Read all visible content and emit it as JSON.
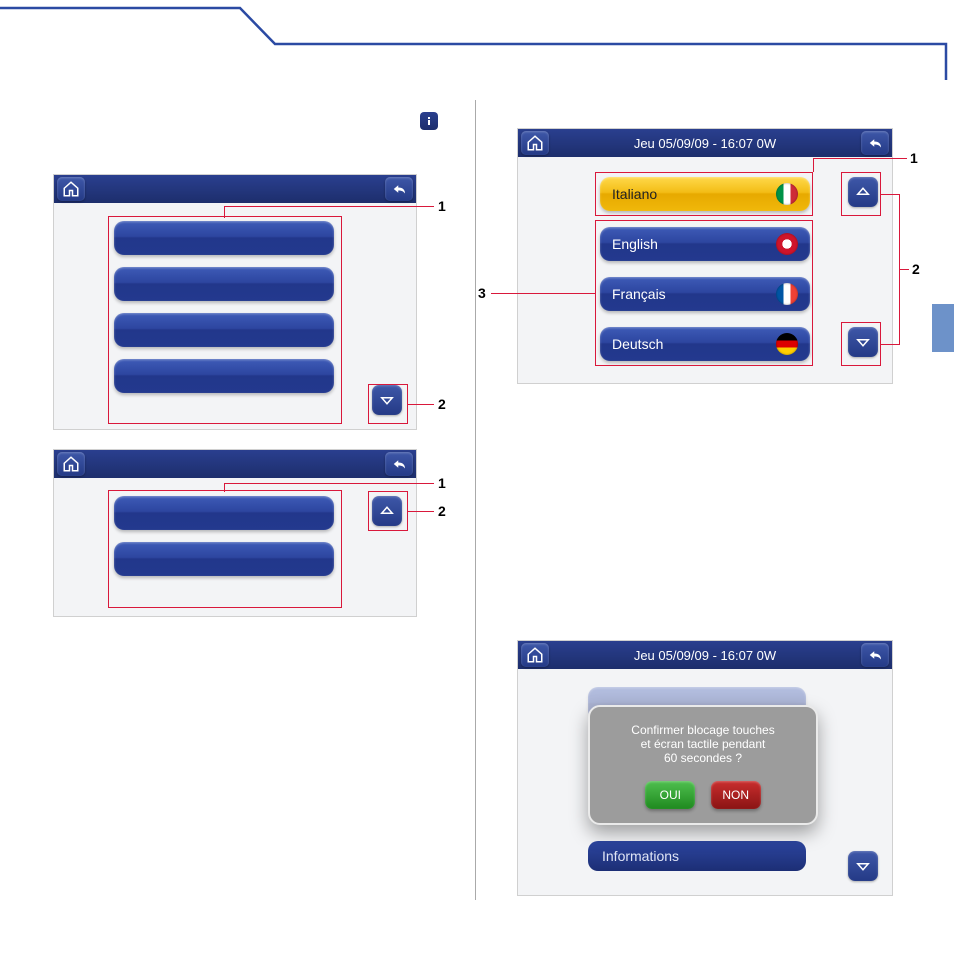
{
  "titlebar_datetime": "Jeu 05/09/09 - 16:07   0W",
  "language": {
    "items": [
      {
        "label": "Italiano",
        "flag": "it",
        "selected": true
      },
      {
        "label": "English",
        "flag": "en",
        "selected": false
      },
      {
        "label": "Français",
        "flag": "fr",
        "selected": false
      },
      {
        "label": "Deutsch",
        "flag": "de",
        "selected": false
      }
    ]
  },
  "dialog": {
    "line1": "Confirmer blocage touches",
    "line2": "et écran tactile pendant",
    "line3": "60 secondes ?",
    "yes": "OUI",
    "no": "NON",
    "behind_label": "Informations"
  },
  "callouts": {
    "n1": "1",
    "n2": "2",
    "n3": "3"
  }
}
